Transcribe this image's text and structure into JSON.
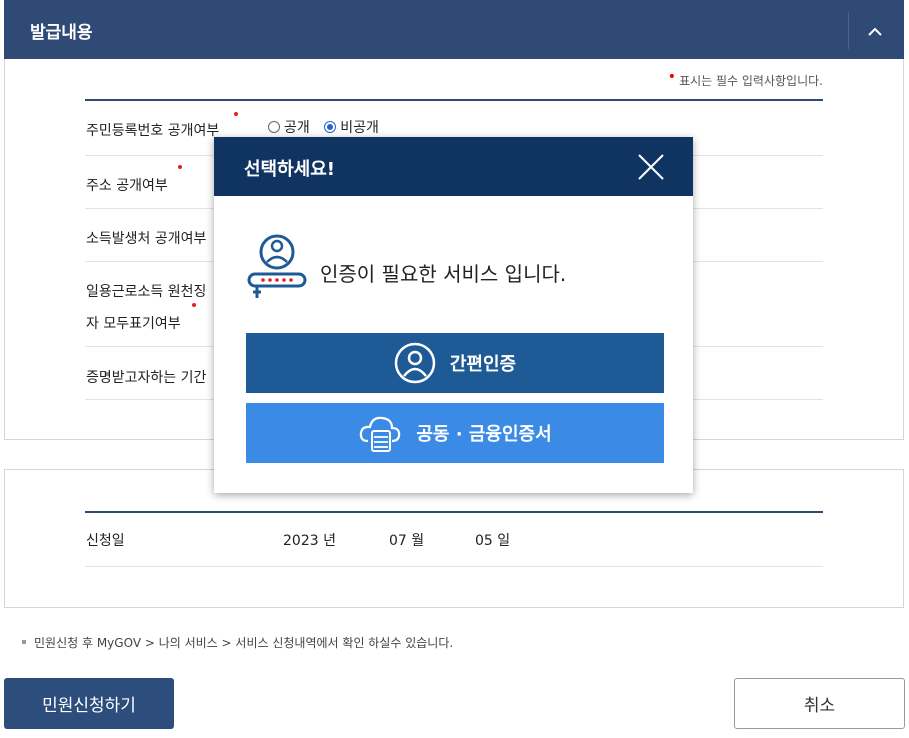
{
  "header": {
    "title": "발급내용"
  },
  "required_note": "표시는 필수 입력사항입니다.",
  "rows": [
    {
      "label": "주민등록번호 공개여부"
    },
    {
      "label": "주소 공개여부"
    },
    {
      "label": "소득발생처 공개여부"
    },
    {
      "label_line1": "일용근로소득 원천징",
      "label_line2": "자 모두표기여부"
    },
    {
      "label": "증명받고자하는 기간"
    }
  ],
  "ssn_options": {
    "option1": "공개",
    "option2": "비공개",
    "selected": "비공개"
  },
  "application_date": {
    "label": "신청일",
    "year": "2023",
    "year_unit": "년",
    "month": "07",
    "month_unit": "월",
    "day": "05",
    "day_unit": "일"
  },
  "note": "민원신청 후 MyGOV > 나의 서비스 > 서비스 신청내역에서 확인 하실수 있습니다.",
  "buttons": {
    "submit": "민원신청하기",
    "cancel": "취소"
  },
  "modal": {
    "title": "선택하세요!",
    "message": "인증이 필요한 서비스 입니다.",
    "simple_auth": "간편인증",
    "certificate_auth": "공동 · 금융인증서"
  },
  "colors": {
    "header": "#2f4a75",
    "modal_header": "#0f3462",
    "simple_button": "#1e5b96",
    "cert_button": "#3a8ae6",
    "required": "#e0202a"
  }
}
